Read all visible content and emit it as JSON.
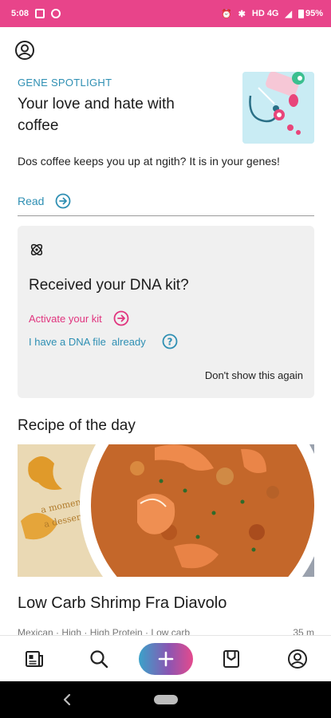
{
  "status": {
    "time": "5:08",
    "network": "HD 4G",
    "battery": "95%"
  },
  "spotlight": {
    "kicker": "GENE SPOTLIGHT",
    "title": "Your love and hate with coffee",
    "description": "Dos coffee keeps you up at ngith? It is in your genes!",
    "read_label": "Read"
  },
  "dna_card": {
    "title": "Received your DNA kit?",
    "activate_label": "Activate your kit",
    "dna_file_label": "I have a DNA file  already",
    "dismiss_label": "Don't show this again"
  },
  "recipe": {
    "section_title": "Recipe of the day",
    "title": "Low Carb Shrimp Fra Diavolo",
    "meta_left": "Mexican · High · High Protein · Low carb",
    "meta_right": "35 m"
  },
  "bottom_nav": {
    "icons": [
      "feed-icon",
      "search-icon",
      "add-icon",
      "bookmark-icon",
      "profile-icon"
    ]
  },
  "colors": {
    "accent_pink": "#e8448a",
    "link_blue": "#2e8fb3",
    "card_gray": "#f0f0f0"
  }
}
